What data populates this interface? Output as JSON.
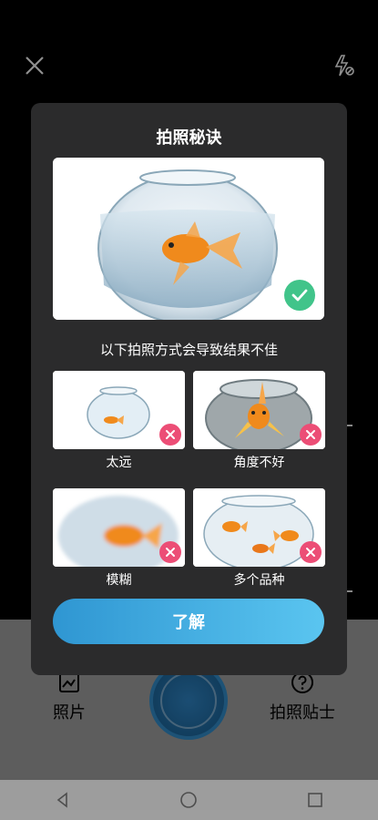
{
  "camera": {
    "bottom": {
      "photos_label": "照片",
      "tips_label": "拍照贴士"
    }
  },
  "modal": {
    "title": "拍照秘诀",
    "subtitle": "以下拍照方式会导致结果不佳",
    "examples": [
      {
        "label": "太远"
      },
      {
        "label": "角度不好"
      },
      {
        "label": "模糊"
      },
      {
        "label": "多个品种"
      }
    ],
    "cta_label": "了解"
  },
  "colors": {
    "cta_start": "#2f96d2",
    "cta_end": "#5ac5f0",
    "good": "#41c48a",
    "bad": "#ec4e76"
  },
  "icons": [
    "close-icon",
    "flash-auto-icon",
    "gallery-icon",
    "help-icon",
    "check-icon",
    "cross-icon",
    "back-icon",
    "home-icon",
    "recents-icon"
  ]
}
